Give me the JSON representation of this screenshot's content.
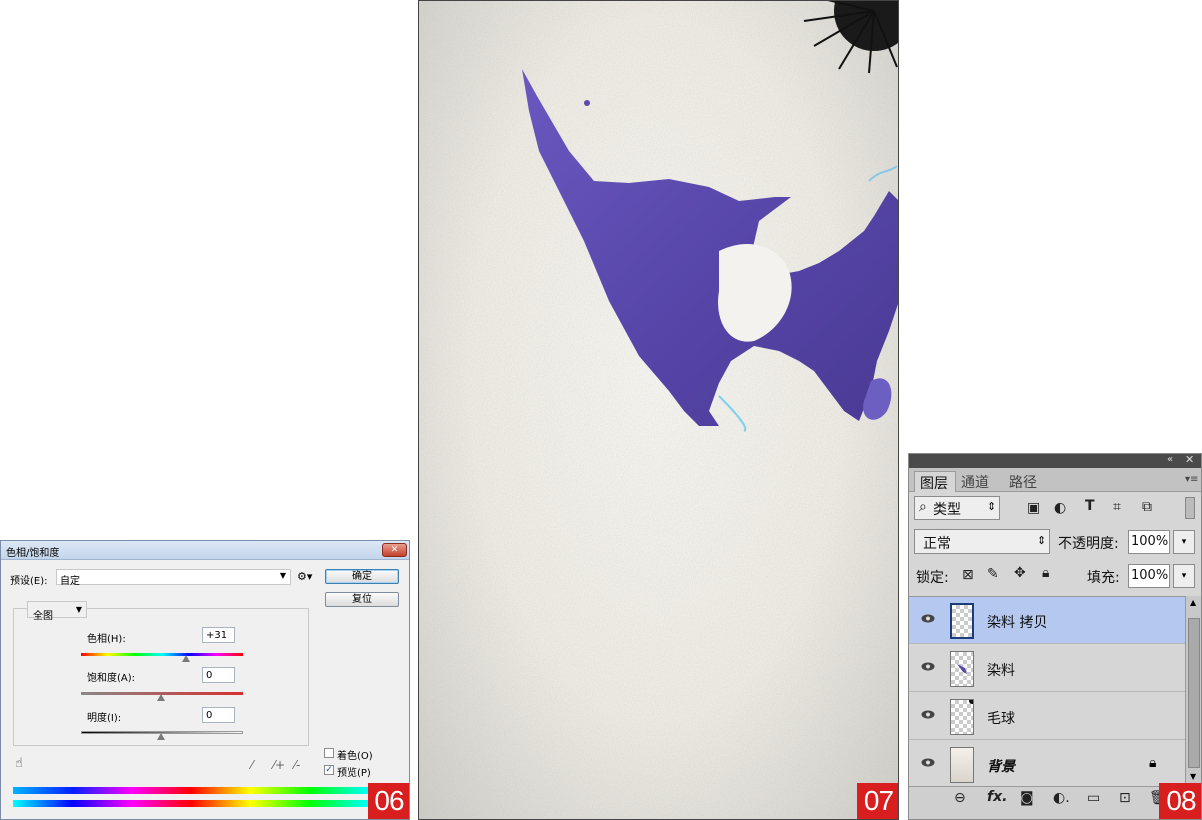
{
  "hue_sat_dialog": {
    "title": "色相/饱和度",
    "close_label": "✕",
    "preset_label": "预设(E):",
    "preset_value": "自定",
    "ok_label": "确定",
    "reset_label": "复位",
    "channel_value": "全图",
    "hue_label": "色相(H):",
    "hue_value": "+31",
    "saturation_label": "饱和度(A):",
    "saturation_value": "0",
    "lightness_label": "明度(I):",
    "lightness_value": "0",
    "colorize_label": "着色(O)",
    "preview_label": "预览(P)",
    "preview_checked": true,
    "colorize_checked": false,
    "badge": "06"
  },
  "canvas_panel": {
    "badge": "07"
  },
  "layers_panel": {
    "tabs": [
      "图层",
      "通道",
      "路径"
    ],
    "filter_label": "类型",
    "blend_mode": "正常",
    "opacity_label": "不透明度:",
    "opacity_value": "100%",
    "lock_label": "锁定:",
    "fill_label": "填充:",
    "fill_value": "100%",
    "layers": [
      {
        "name": "染料 拷贝",
        "selected": true
      },
      {
        "name": "染料",
        "selected": false
      },
      {
        "name": "毛球",
        "selected": false
      },
      {
        "name": "背景",
        "selected": false,
        "locked": true
      }
    ],
    "badge": "08"
  },
  "colors": {
    "badge": "#d81e1e",
    "selected_layer": "#b5c8f0",
    "paint": "#5a4aa8"
  }
}
